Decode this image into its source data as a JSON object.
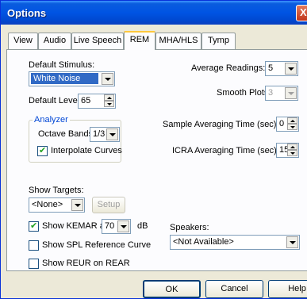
{
  "window": {
    "title": "Options",
    "close_glyph": "X"
  },
  "tabs": [
    {
      "label": "View"
    },
    {
      "label": "Audio"
    },
    {
      "label": "Live Speech"
    },
    {
      "label": "REM"
    },
    {
      "label": "MHA/HLS"
    },
    {
      "label": "Tymp"
    }
  ],
  "active_tab": "REM",
  "rem": {
    "default_stimulus": {
      "label": "Default Stimulus:",
      "value": "White Noise"
    },
    "default_level": {
      "label": "Default Level:",
      "value": "65"
    },
    "analyzer": {
      "title": "Analyzer",
      "octave_bands": {
        "label": "Octave Bands:",
        "value": "1/3"
      },
      "interpolate": {
        "label": "Interpolate Curves",
        "checked": true
      }
    },
    "show_targets": {
      "label": "Show Targets:",
      "value": "<None>",
      "setup_label": "Setup"
    },
    "show_kemar": {
      "label": "Show KEMAR at",
      "value": "70",
      "unit": "dB",
      "checked": true
    },
    "show_spl_reference": {
      "label": "Show SPL Reference Curve",
      "checked": false
    },
    "show_reur": {
      "label": "Show REUR on REAR",
      "checked": false
    },
    "average_readings": {
      "label": "Average Readings:",
      "value": "5"
    },
    "smooth_plots": {
      "label": "Smooth Plots:",
      "value": "3"
    },
    "sample_averaging": {
      "label": "Sample Averaging Time (sec):",
      "value": "0"
    },
    "icra_averaging": {
      "label": "ICRA Averaging Time (sec):",
      "value": "15"
    },
    "speakers": {
      "label": "Speakers:",
      "value": "<Not Available>"
    }
  },
  "buttons": {
    "ok": "OK",
    "cancel": "Cancel",
    "help": "Help"
  },
  "colors": {
    "titlebar": "#0054e3",
    "tab_highlight": "#ffc83c",
    "selection": "#316ac5",
    "check": "#21a121"
  }
}
